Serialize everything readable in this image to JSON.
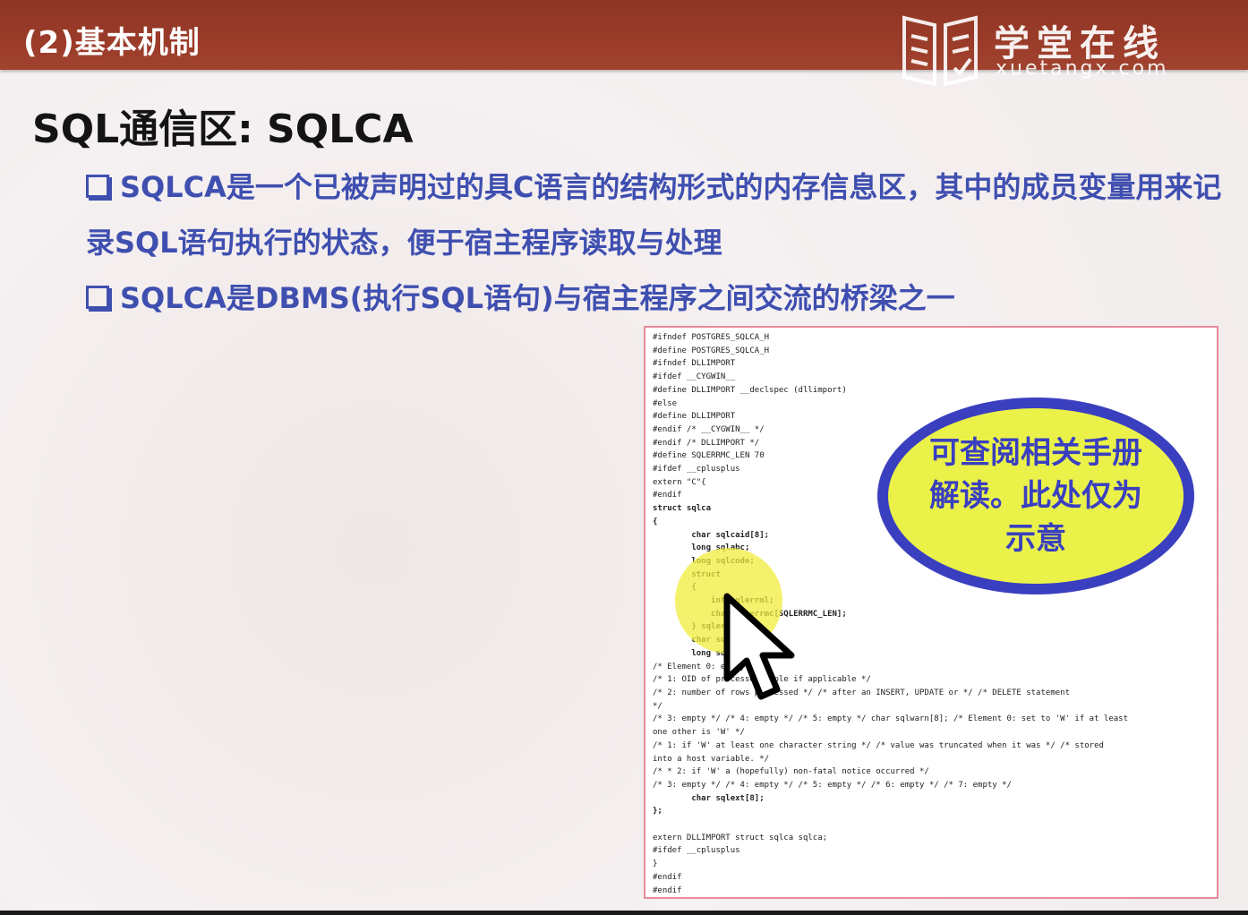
{
  "header": {
    "subtitle": "(2)基本机制",
    "logo_cn": "学堂在线",
    "logo_en": "xuetangx.com"
  },
  "title": "SQL通信区: SQLCA",
  "bullets": [
    "SQLCA是一个已被声明过的具C语言的结构形式的内存信息区，其中的成员变量用来记录SQL语句执行的状态，便于宿主程序读取与处理",
    "SQLCA是DBMS(执行SQL语句)与宿主程序之间交流的桥梁之一"
  ],
  "code": {
    "lines": [
      "#ifndef POSTGRES_SQLCA_H",
      "#define POSTGRES_SQLCA_H",
      "#ifndef DLLIMPORT",
      "#ifdef __CYGWIN__",
      "#define DLLIMPORT __declspec (dllimport)",
      "#else",
      "#define DLLIMPORT",
      "#endif /* __CYGWIN__ */",
      "#endif /* DLLIMPORT */",
      "#define SQLERRMC_LEN 70",
      "#ifdef __cplusplus",
      "extern \"C\"{",
      "#endif",
      "struct sqlca",
      "{",
      "        char sqlcaid[8];",
      "        long sqlabc;",
      "        long sqlcode;",
      "        struct",
      "        {",
      "            int sqlerrml;",
      "            char sqlerrmc[SQLERRMC_LEN];",
      "        } sqlerrm;",
      "        char sqlerrp[8];",
      "        long sqlerrd[6];",
      "/* Element 0: empty */",
      "/* 1: OID of processed tuple if applicable */",
      "/* 2: number of rows processed */ /* after an INSERT, UPDATE or */ /* DELETE statement",
      "*/",
      "/* 3: empty */ /* 4: empty */ /* 5: empty */ char sqlwarn[8]; /* Element 0: set to 'W' if at least",
      "one other is 'W' */",
      "/* 1: if 'W' at least one character string */ /* value was truncated when it was */ /* stored",
      "into a host variable. */",
      "/* * 2: if 'W' a (hopefully) non-fatal notice occurred */",
      "/* 3: empty */ /* 4: empty */ /* 5: empty */ /* 6: empty */ /* 7: empty */",
      "        char sqlext[8];",
      "};",
      "",
      "extern DLLIMPORT struct sqlca sqlca;",
      "#ifdef __cplusplus",
      "}",
      "#endif",
      "#endif"
    ],
    "bold_line_indices": [
      13,
      14,
      15,
      16,
      17,
      18,
      19,
      20,
      21,
      22,
      23,
      24,
      35,
      36
    ]
  },
  "callout": {
    "text": "可查阅相关手册解读。此处仅为示意"
  },
  "colors": {
    "header_bg": "#9b3b29",
    "bullet_text": "#3f4fb0",
    "callout_fill": "#eaf24a",
    "callout_border": "#3a3fc0",
    "panel_border": "#e88b9a"
  },
  "icons": [
    "book-logo-icon",
    "bullet-box-icon",
    "mouse-pointer-icon"
  ]
}
